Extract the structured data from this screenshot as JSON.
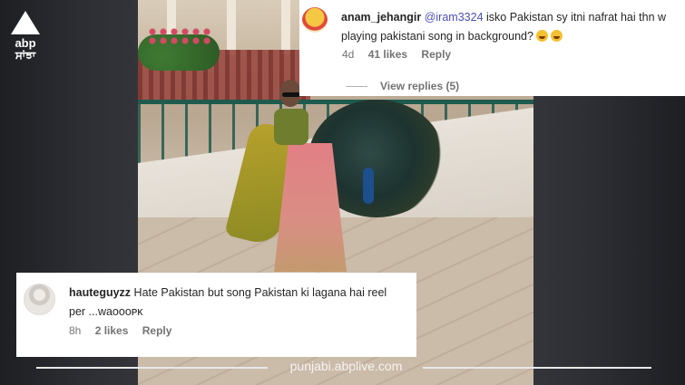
{
  "brand": {
    "logo_text": "abp",
    "logo_subtext": "ਸਾਂਝਾ",
    "watermark": "punjabi.abplive.com"
  },
  "comment_top": {
    "username": "anam_jehangir",
    "mention": "@iram3324",
    "text_line1": " isko Pakistan sy itni nafrat hai thn w",
    "text_line2": "playing pakistani song in background?",
    "emojis": [
      "face-with-tears-of-joy-icon",
      "face-with-tears-of-joy-icon"
    ],
    "time": "4d",
    "likes": "41 likes",
    "reply": "Reply",
    "view_replies": "View replies (5)"
  },
  "comment_bottom": {
    "username": "hauteguyzz",
    "text": " Hate Pakistan but song Pakistan ki lagana hai reel per ...waoooᴘᴋ",
    "time": "8h",
    "likes": "2 likes",
    "reply": "Reply"
  },
  "colors": {
    "mention": "#4a4fb6",
    "meta": "#737373",
    "background": "#2b2d31"
  }
}
